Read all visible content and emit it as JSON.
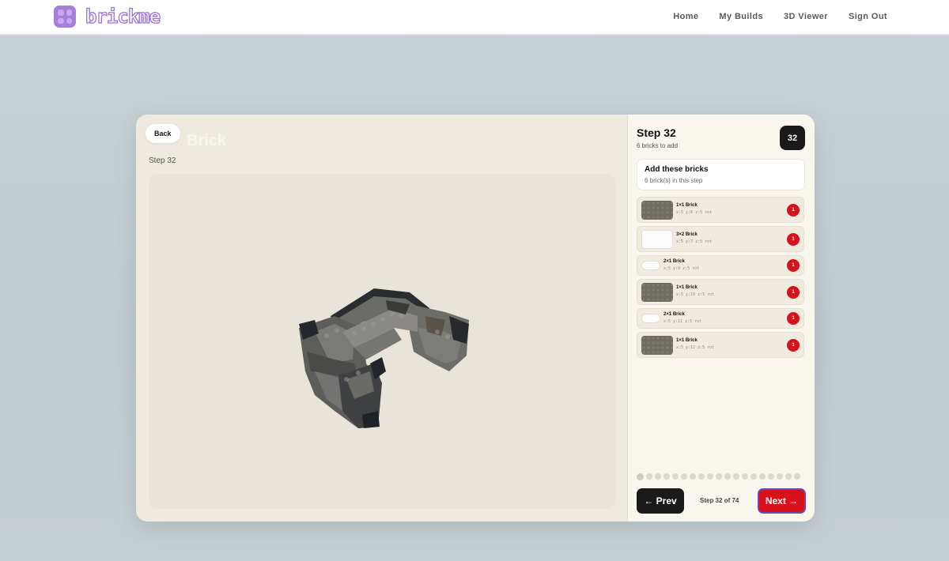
{
  "app": {
    "logo_text": "brickme"
  },
  "nav": {
    "home": "Home",
    "my_builds": "My Builds",
    "viewer": "3D Viewer",
    "sign_out": "Sign Out"
  },
  "builder": {
    "back_label": "Back",
    "title": "Brick",
    "step_label": "Step 32"
  },
  "panel": {
    "step_title": "Step 32",
    "bricks_to_add": "6 bricks to add",
    "step_badge": "32",
    "add_heading": "Add these bricks",
    "add_sub": "6 brick(s) in this step",
    "bricks": [
      {
        "name": "1×1 Brick",
        "coords": "x:5 y:6 z:5 rot",
        "qty": "1",
        "color": "#6f6d61"
      },
      {
        "name": "3×2 Brick",
        "coords": "x:5 y:7 z:5 rot",
        "qty": "1",
        "color": "#fdfdfd"
      },
      {
        "name": "2×1 Brick",
        "coords": "x:5 y:9 z:5 rot",
        "qty": "1",
        "color": "#fdfdfd"
      },
      {
        "name": "1×1 Brick",
        "coords": "x:5 y:10 z:5 rot",
        "qty": "1",
        "color": "#6f6d61"
      },
      {
        "name": "2×1 Brick",
        "coords": "x:5 y:11 z:5 rot",
        "qty": "1",
        "color": "#fdfdfd"
      },
      {
        "name": "1×1 Brick",
        "coords": "x:5 y:12 z:5 rot",
        "qty": "1",
        "color": "#6f6d61"
      }
    ],
    "prev_label": "← Prev",
    "step_of": "Step 32 of 74",
    "next_label": "Next →"
  },
  "colors": {
    "accent": "#a67fd9",
    "next": "#d8111b",
    "qty": "#d6121a"
  }
}
